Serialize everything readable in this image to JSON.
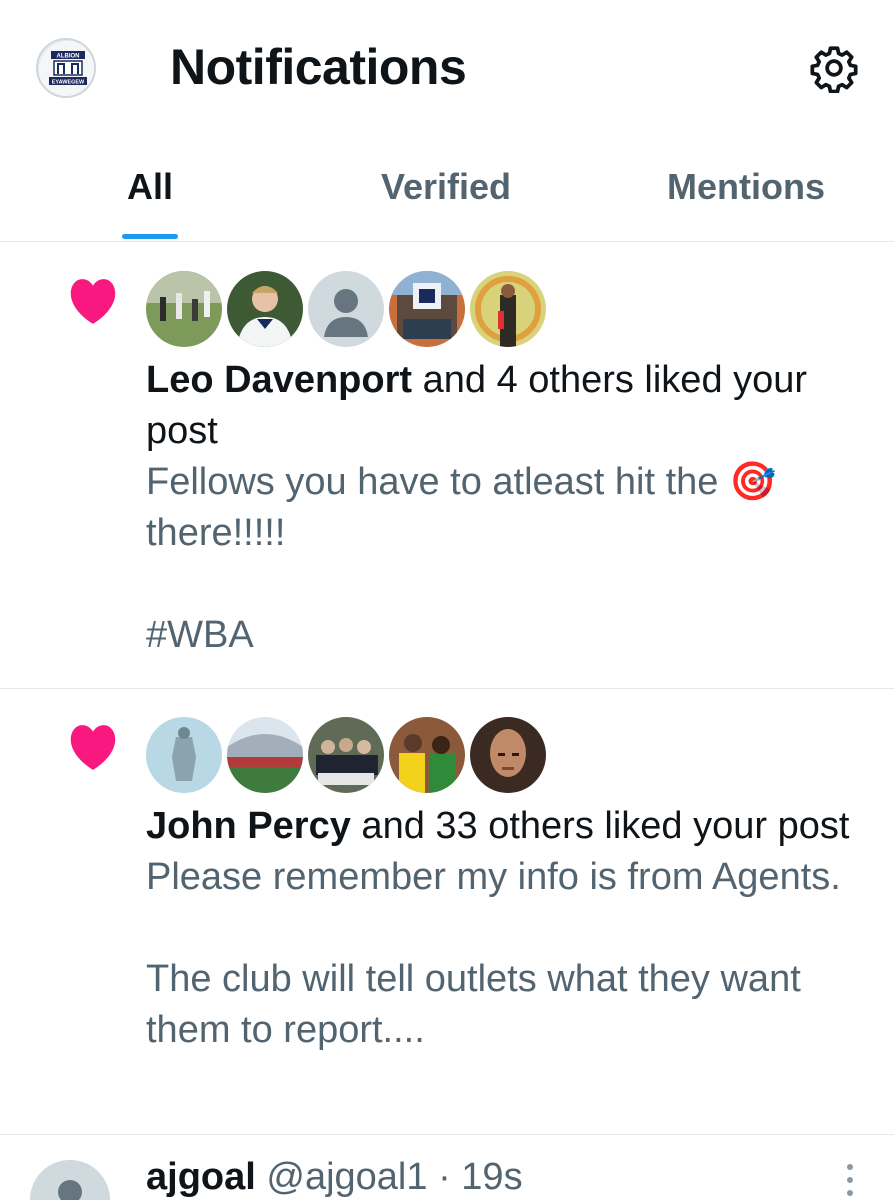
{
  "header": {
    "title": "Notifications",
    "profile_icon": "club-crest-avatar",
    "profile_crest_top": "ALBION",
    "profile_crest_bottom": "EYAWEGEW",
    "settings_icon": "gear-icon"
  },
  "tabs": [
    {
      "label": "All",
      "active": true
    },
    {
      "label": "Verified",
      "active": false
    },
    {
      "label": "Mentions",
      "active": false
    }
  ],
  "colors": {
    "accent": "#1d9bf0",
    "like": "#f91880",
    "text_primary": "#0f1419",
    "text_secondary": "#536471"
  },
  "notifications": [
    {
      "icon": "heart-icon",
      "avatars": [
        "football-team-photo",
        "player-portrait",
        "default-avatar",
        "club-stadium-photo",
        "referee-photo"
      ],
      "actor": "Leo Davenport",
      "action": " and 4 others liked your post",
      "post_text": "Fellows you have to atleast hit the 🎯 there!!!!!\n\n#WBA"
    },
    {
      "icon": "heart-icon",
      "avatars": [
        "statue-photo",
        "stadium-photo",
        "group-photo",
        "celebration-photo",
        "bald-man-portrait"
      ],
      "actor": "John Percy",
      "action": " and 33 others liked your post",
      "post_text": "Please remember my info is from Agents.\n\nThe club will tell outlets what they want them to report...."
    }
  ],
  "tweet": {
    "name": "ajgoal",
    "handle": "@ajgoal1",
    "separator": " · ",
    "time": "19s",
    "more_icon": "more-vertical-icon"
  }
}
